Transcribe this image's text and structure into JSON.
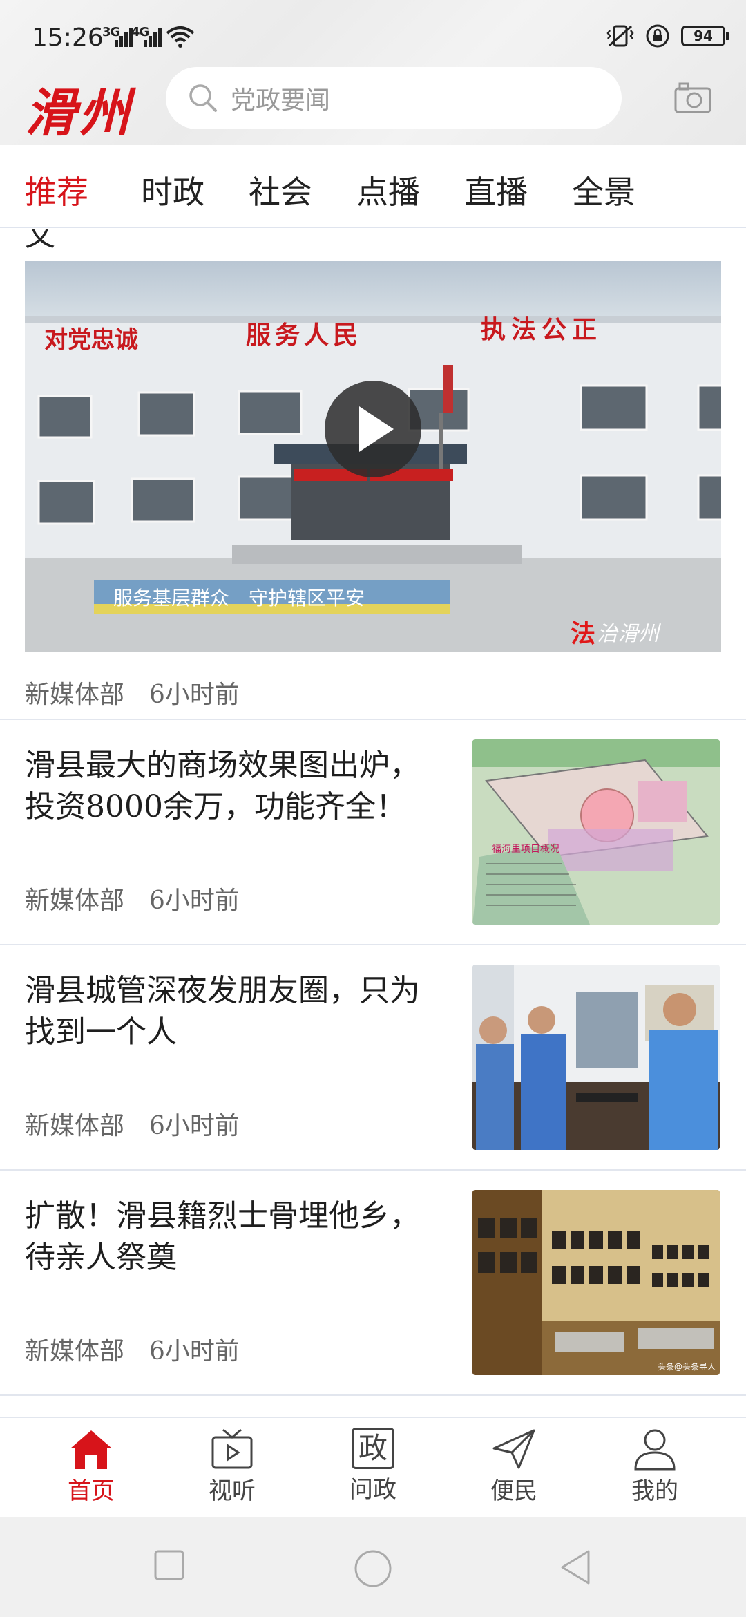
{
  "status_bar": {
    "time": "15:26",
    "network_1": "3G",
    "network_2": "4G",
    "battery": "94"
  },
  "header": {
    "logo": "滑州",
    "search_placeholder": "党政要闻"
  },
  "tabs": [
    {
      "label": "推荐",
      "active": true
    },
    {
      "label": "时政",
      "active": false
    },
    {
      "label": "社会",
      "active": false
    },
    {
      "label": "点播",
      "active": false
    },
    {
      "label": "直播",
      "active": false
    },
    {
      "label": "全景",
      "active": false
    }
  ],
  "feed": {
    "clipped_text": "文",
    "video_item": {
      "banner_1": "对党忠诚",
      "banner_2": "服务人民",
      "banner_3": "执法公正",
      "caption": "服务基层群众　守护辖区平安",
      "watermark_red": "法",
      "watermark_rest": "治滑州",
      "source": "新媒体部",
      "time": "6小时前"
    },
    "articles": [
      {
        "title": "滑县最大的商场效果图出炉，投资8000余万，功能齐全！",
        "source": "新媒体部",
        "time": "6小时前",
        "thumb_text": "福海里项目概况"
      },
      {
        "title": "滑县城管深夜发朋友圈，只为找到一个人",
        "source": "新媒体部",
        "time": "6小时前"
      },
      {
        "title": "扩散！滑县籍烈士骨埋他乡，待亲人祭奠",
        "source": "新媒体部",
        "time": "6小时前",
        "thumb_text": "头条@头条寻人"
      }
    ]
  },
  "bottom_nav": [
    {
      "label": "首页",
      "icon": "home-icon",
      "active": true
    },
    {
      "label": "视听",
      "icon": "tv-icon",
      "active": false
    },
    {
      "label": "问政",
      "icon": "zheng-icon",
      "glyph": "政",
      "active": false
    },
    {
      "label": "便民",
      "icon": "send-icon",
      "active": false
    },
    {
      "label": "我的",
      "icon": "user-icon",
      "active": false
    }
  ],
  "colors": {
    "accent": "#d7141a",
    "divider": "#e2e6ee"
  }
}
